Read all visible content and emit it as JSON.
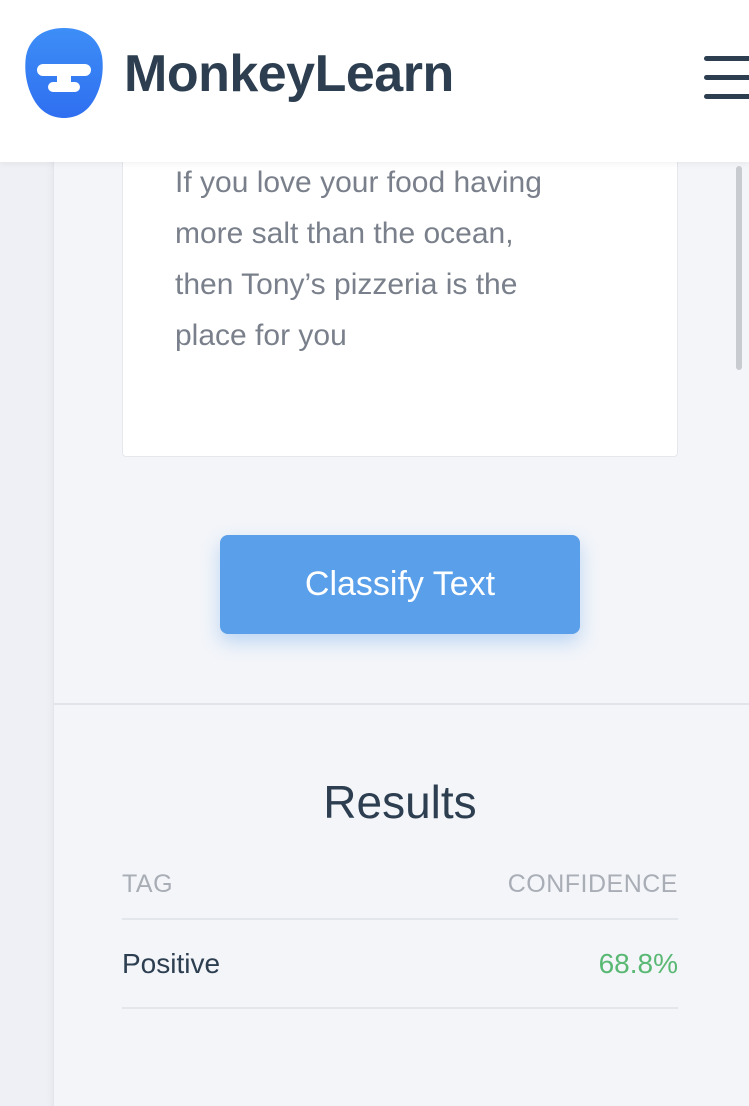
{
  "header": {
    "brand": "MonkeyLearn",
    "logo_icon": "monkeylearn-logo-icon",
    "menu_icon": "hamburger-menu-icon"
  },
  "input": {
    "text_lines": [
      "If you love your food having",
      "more salt than the ocean,",
      "then Tony’s pizzeria is the",
      "place for you"
    ]
  },
  "actions": {
    "classify_label": "Classify Text"
  },
  "results": {
    "title": "Results",
    "columns": [
      "TAG",
      "CONFIDENCE"
    ],
    "rows": [
      {
        "tag": "Positive",
        "confidence": "68.8%"
      }
    ]
  },
  "colors": {
    "accent": "#5a9fea",
    "positive": "#59b873",
    "text_dark": "#2c3e50",
    "logo_blue": "#3a7ff5"
  }
}
